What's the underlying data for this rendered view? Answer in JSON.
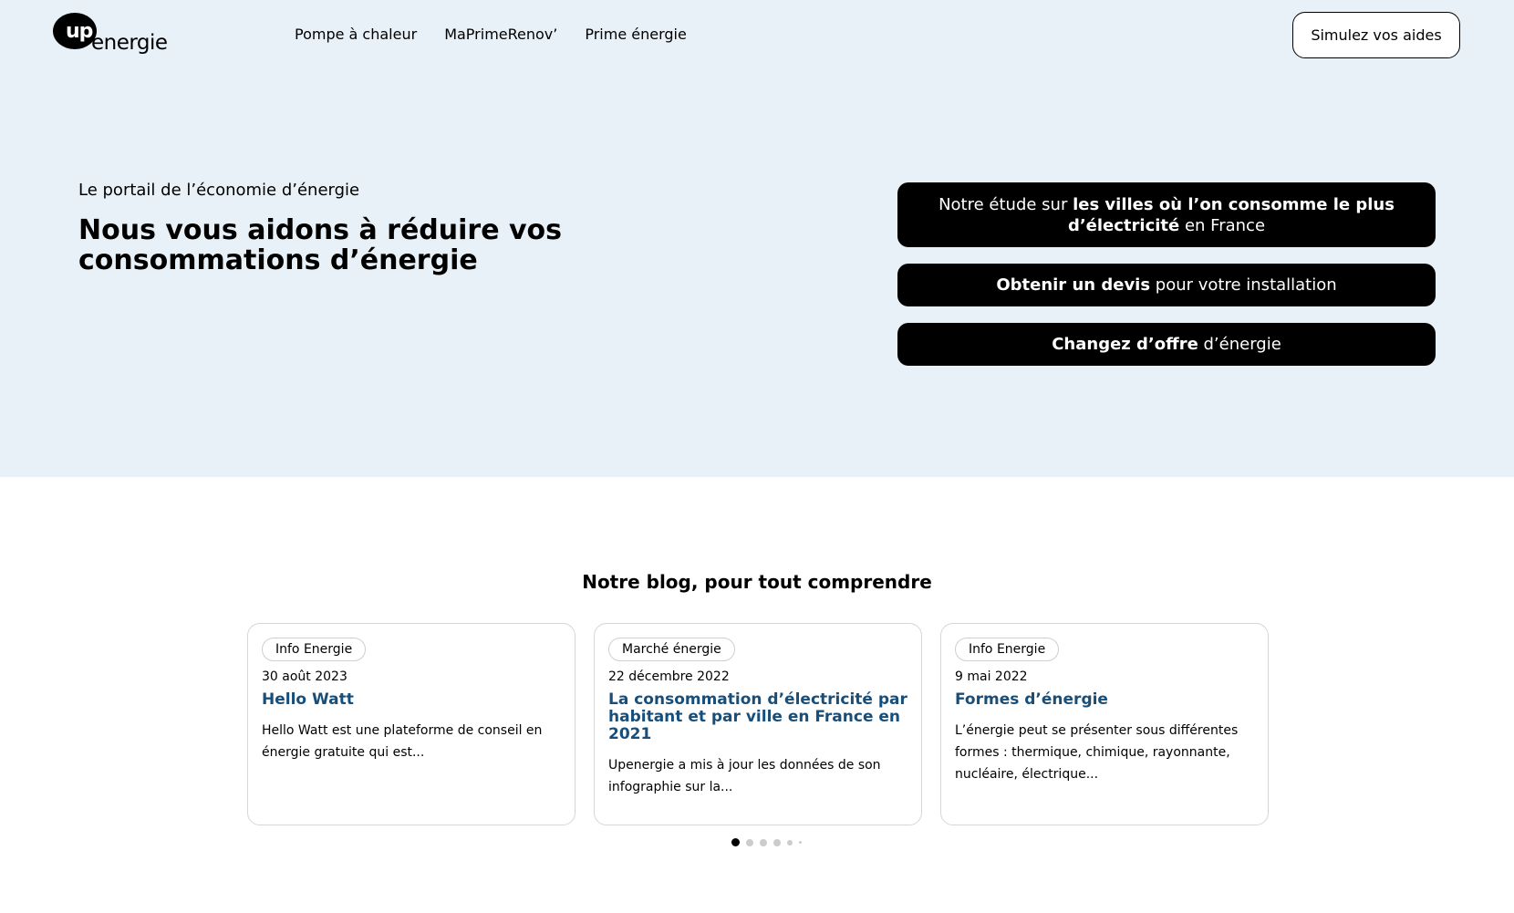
{
  "brand": {
    "logo_up": "up",
    "logo_energie": "energie"
  },
  "nav": {
    "items": [
      "Pompe à chaleur",
      "MaPrimeRenov’",
      "Prime énergie"
    ]
  },
  "header": {
    "cta_label": "Simulez vos aides"
  },
  "hero": {
    "tagline": "Le portail de l’économie d’énergie",
    "headline": "Nous vous aidons à réduire vos consommations d’énergie",
    "actions": [
      {
        "pre": "Notre étude sur ",
        "bold": "les villes où l’on consomme le plus d’électricité",
        "post": " en France"
      },
      {
        "pre": "",
        "bold": "Obtenir un devis",
        "post": " pour votre installation"
      },
      {
        "pre": "",
        "bold": "Changez d’offre",
        "post": " d’énergie"
      }
    ]
  },
  "blog": {
    "title": "Notre blog, pour tout comprendre",
    "cards": [
      {
        "category": "Info Energie",
        "date": "30 août 2023",
        "title": "Hello Watt",
        "excerpt": "Hello Watt est une plateforme de conseil en énergie gratuite qui est..."
      },
      {
        "category": "Marché énergie",
        "date": "22 décembre 2022",
        "title": "La consommation d’électricité par habitant et par ville en France en 2021",
        "excerpt": "Upenergie a mis à jour les données de son infographie sur la..."
      },
      {
        "category": "Info Energie",
        "date": "9 mai 2022",
        "title": "Formes d’énergie",
        "excerpt": "L’énergie peut se présenter sous différentes formes : thermique, chimique, rayonnante, nucléaire, électrique..."
      }
    ],
    "pagination": {
      "total": 6,
      "active": 1
    }
  },
  "colors": {
    "hero_bg": "#e8f1f7",
    "card_title": "#184e7a",
    "button_bg": "#000000"
  }
}
